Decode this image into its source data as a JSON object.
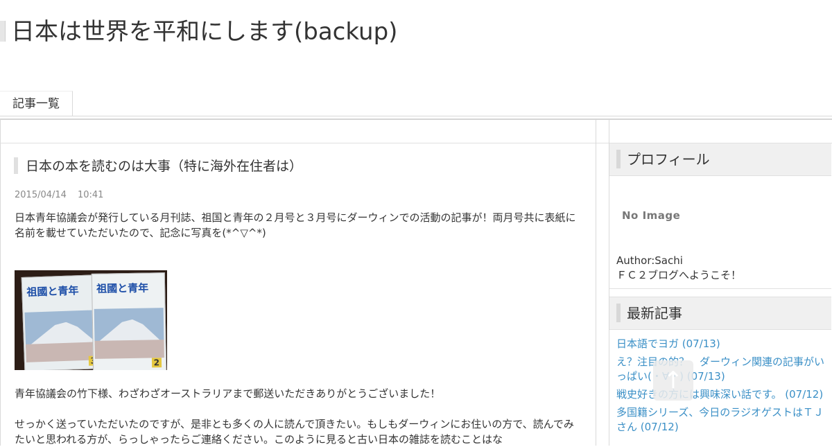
{
  "site": {
    "title": "日本は世界を平和にします(backup)"
  },
  "nav": {
    "items": [
      "記事一覧"
    ]
  },
  "article": {
    "title": "日本の本を読むのは大事（特に海外在住者は）",
    "date": "2015/04/14",
    "time": "10:41",
    "paragraphs": [
      "日本青年協議会が発行している月刊誌、祖国と青年の２月号と３月号にダーウィンでの活動の記事が！両月号共に表紙に名前を載せていただいたので、記念に写真を(*^▽^*)",
      "青年協議会の竹下様、わざわざオーストラリアまで郵送いただきありがとうございました！",
      "せっかく送っていただいたのですが、是非とも多くの人に読んで頂きたい。もしもダーウィンにお住いの方で、読んでみたいと思われる方が、らっしゃったらご連絡ください。このように見ると古い日本の雑誌を読むことはな"
    ],
    "photo": {
      "magazine_title": "祖國と青年",
      "issue_numbers": [
        "3",
        "2"
      ]
    }
  },
  "sidebar": {
    "profile": {
      "heading": "プロフィール",
      "image_placeholder": "No Image",
      "author": "Author:Sachi",
      "greeting": "ＦＣ２ブログへようこそ！"
    },
    "recent": {
      "heading": "最新記事",
      "items": [
        "日本語でヨガ (07/13)",
        "え？注目の的？　ダーウィン関連の記事がいっぱい(・∀・) (07/13)",
        "戦史好きの方には興味深い話です。 (07/12)",
        "多国籍シリーズ、今日のラジオゲストはＴＪさん (07/12)"
      ]
    }
  },
  "icons": {
    "scroll_top": "arrow-up-icon"
  },
  "colors": {
    "link": "#3a8fc6",
    "text": "#333333",
    "heading_bg": "#f0f0f0"
  }
}
